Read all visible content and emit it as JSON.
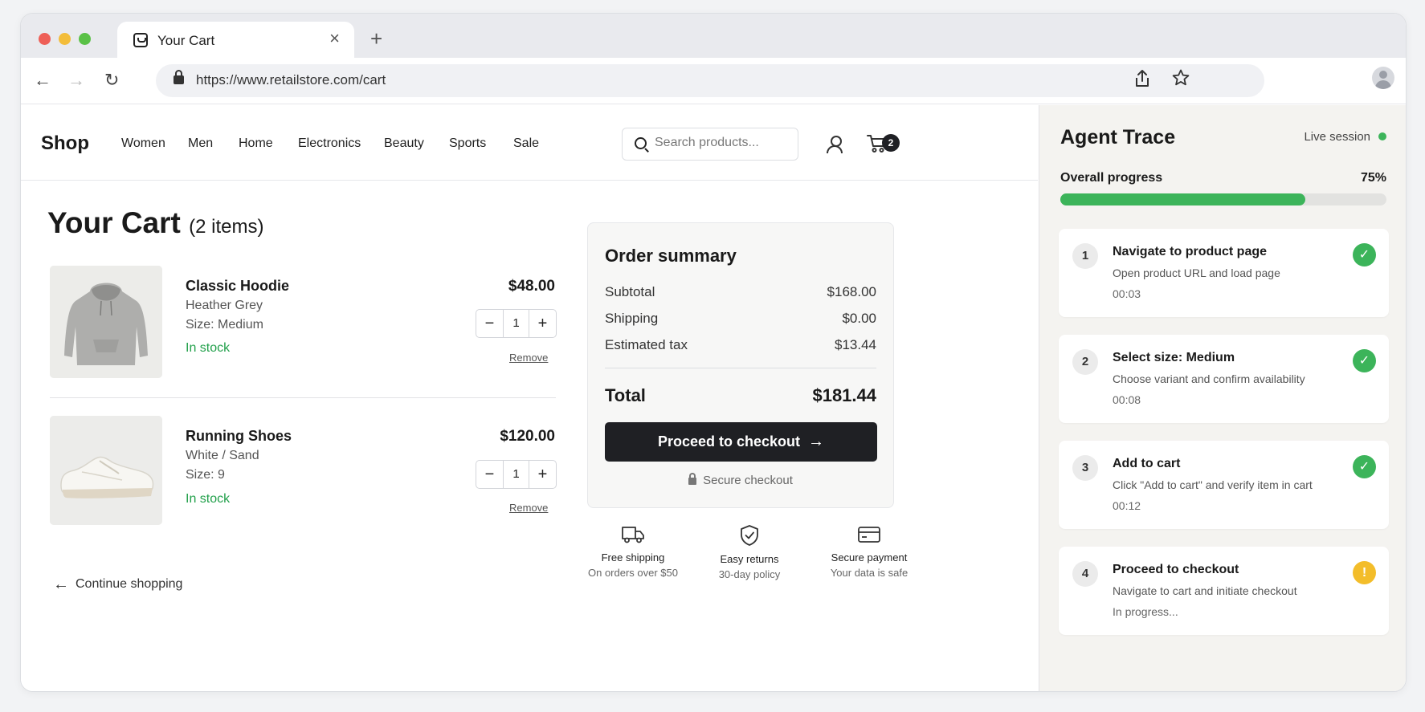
{
  "browser": {
    "tab_title": "Your Cart",
    "url": "https://www.retailstore.com/cart"
  },
  "store": {
    "logo": "Shop",
    "nav": [
      "Women",
      "Men",
      "Home",
      "Electronics",
      "Beauty",
      "Sports",
      "Sale"
    ],
    "search_placeholder": "Search products...",
    "cart_count": "2"
  },
  "cart": {
    "title": "Your Cart",
    "count_label": "(2 items)",
    "items": [
      {
        "name": "Classic Hoodie",
        "color": "Heather Grey",
        "size": "Size: Medium",
        "stock": "In stock",
        "price": "$48.00",
        "qty": "1",
        "remove": "Remove"
      },
      {
        "name": "Running Shoes",
        "color": "White / Sand",
        "size": "Size: 9",
        "stock": "In stock",
        "price": "$120.00",
        "qty": "1",
        "remove": "Remove"
      }
    ],
    "continue": "Continue shopping"
  },
  "summary": {
    "title": "Order summary",
    "rows": [
      {
        "label": "Subtotal",
        "value": "$168.00"
      },
      {
        "label": "Shipping",
        "value": "$0.00"
      },
      {
        "label": "Estimated tax",
        "value": "$13.44"
      }
    ],
    "total_label": "Total",
    "total_value": "$181.44",
    "checkout_label": "Proceed to checkout",
    "secure_label": "Secure checkout"
  },
  "features": [
    {
      "icon": "truck-icon",
      "title": "Free shipping",
      "sub": "On orders over $50"
    },
    {
      "icon": "shield-check-icon",
      "title": "Easy returns",
      "sub": "30-day policy"
    },
    {
      "icon": "credit-card-icon",
      "title": "Secure payment",
      "sub": "Your data is safe"
    }
  ],
  "trace": {
    "title": "Agent Trace",
    "session": "Live session",
    "progress_label": "Overall progress",
    "progress_text": "75%",
    "progress_fraction": 0.75,
    "steps": [
      {
        "num": "1",
        "title": "Navigate to product page",
        "desc": "Open product URL and load page",
        "time": "00:03",
        "status": "done"
      },
      {
        "num": "2",
        "title": "Select size: Medium",
        "desc": "Choose variant and confirm availability",
        "time": "00:08",
        "status": "done"
      },
      {
        "num": "3",
        "title": "Add to cart",
        "desc": "Click \"Add to cart\" and verify item in cart",
        "time": "00:12",
        "status": "done"
      },
      {
        "num": "4",
        "title": "Proceed to checkout",
        "desc": "Navigate to cart and initiate checkout",
        "time": "In progress...",
        "status": "in-progress"
      }
    ]
  },
  "colors": {
    "accent_green": "#3cb45a",
    "stock_green": "#22a04b",
    "warning_yellow": "#f3bd2a",
    "button_dark": "#1f2024"
  }
}
